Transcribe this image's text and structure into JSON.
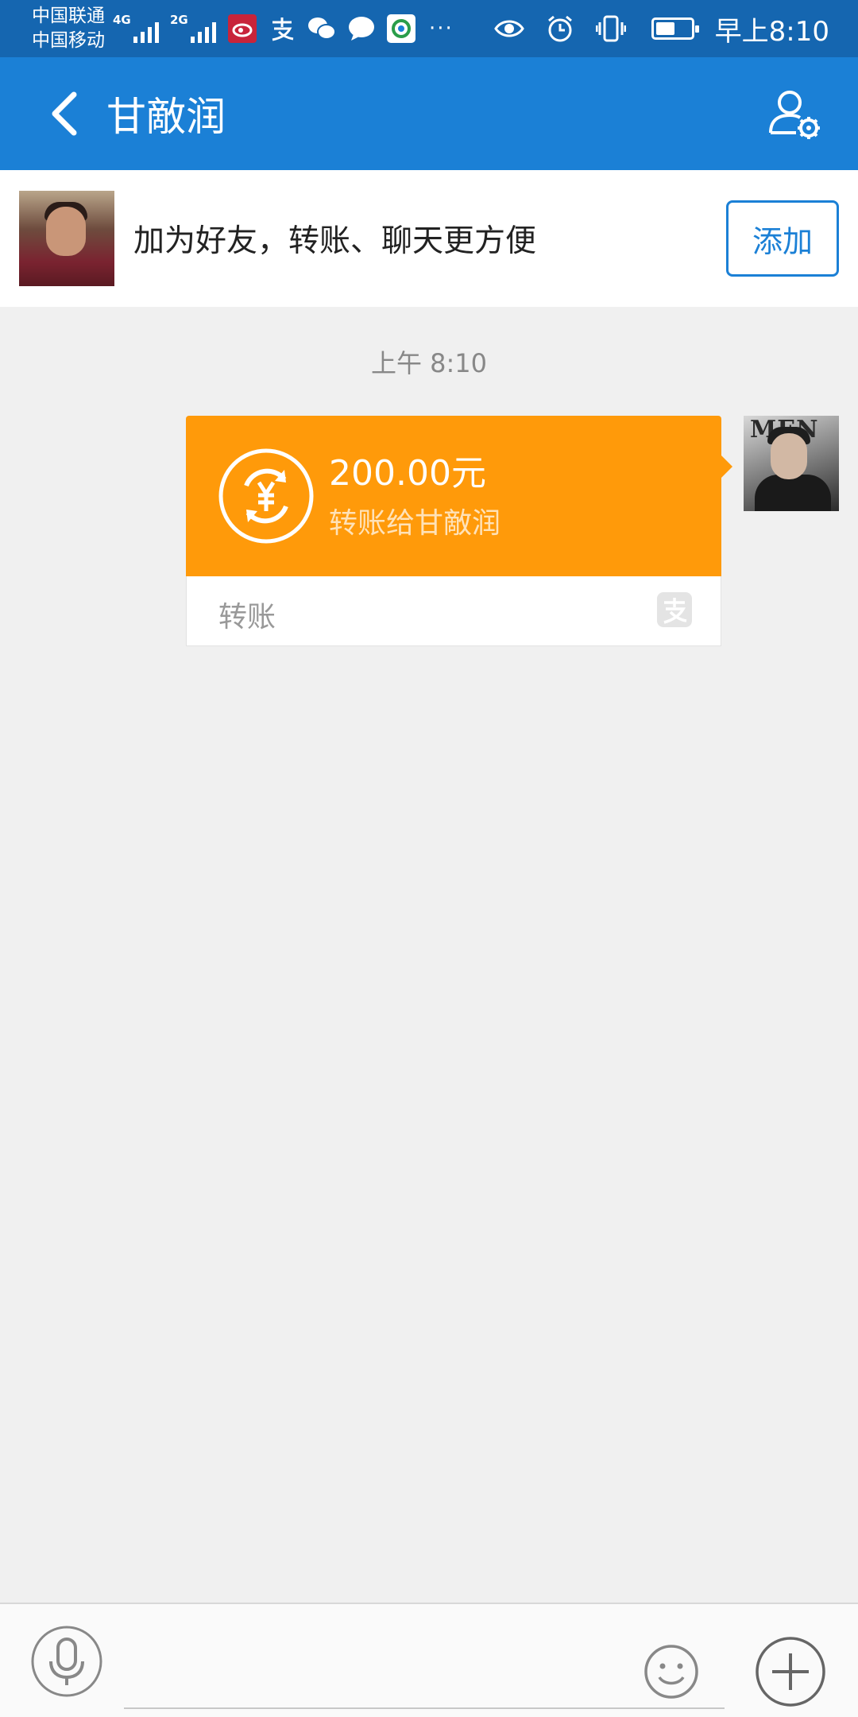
{
  "status_bar": {
    "carrier_1": "中国联通",
    "carrier_2": "中国移动",
    "network_1": "4G",
    "network_2": "2G",
    "more": "···",
    "time": "早上8:10",
    "battery_level": 0.55
  },
  "header": {
    "title": "甘敵润"
  },
  "banner": {
    "text": "加为好友，转账、聊天更方便",
    "add_button": "添加"
  },
  "chat": {
    "timestamp": "上午 8:10",
    "transfer": {
      "amount": "200.00元",
      "subtitle": "转账给甘敵润",
      "label": "转账"
    }
  },
  "input_bar": {
    "placeholder": "",
    "value": ""
  },
  "colors": {
    "status_bar": "#1566b0",
    "header": "#1b80d6",
    "transfer_card": "#ff9a0a",
    "background": "#f0f0f0"
  }
}
